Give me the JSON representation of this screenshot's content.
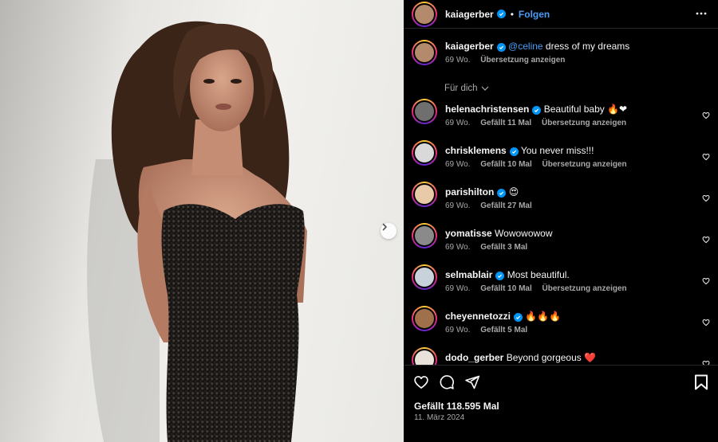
{
  "post": {
    "author": "kaiagerber",
    "follow_label": "Folgen",
    "dot": "•",
    "more_icon": "more-horizontal-icon",
    "caption": {
      "username": "kaiagerber",
      "mention": "@celine",
      "text": " dress of my dreams",
      "age": "69 Wo.",
      "translate": "Übersetzung anzeigen"
    },
    "for_you_label": "Für dich",
    "likes": "Gefällt 118.595 Mal",
    "date": "11. März 2024"
  },
  "comments": [
    {
      "username": "helenachristensen",
      "verified": true,
      "text": "Beautiful baby 🔥❤",
      "age": "69 Wo.",
      "likes": "Gefällt 11 Mal",
      "translate": "Übersetzung anzeigen",
      "avatar_color": "#6f6f6f"
    },
    {
      "username": "chrisklemens",
      "verified": true,
      "text": "You never miss!!!",
      "age": "69 Wo.",
      "likes": "Gefällt 10 Mal",
      "translate": "Übersetzung anzeigen",
      "avatar_color": "#d9d9d9"
    },
    {
      "username": "parishilton",
      "verified": true,
      "text": "😍",
      "age": "69 Wo.",
      "likes": "Gefällt 27 Mal",
      "translate": "",
      "avatar_color": "#e8c9a8"
    },
    {
      "username": "yomatisse",
      "verified": false,
      "text": "Wowowowow",
      "age": "69 Wo.",
      "likes": "Gefällt 3 Mal",
      "translate": "",
      "avatar_color": "#8a8a8a"
    },
    {
      "username": "selmablair",
      "verified": true,
      "text": "Most beautiful.",
      "age": "69 Wo.",
      "likes": "Gefällt 10 Mal",
      "translate": "Übersetzung anzeigen",
      "avatar_color": "#c8d2da"
    },
    {
      "username": "cheyennetozzi",
      "verified": true,
      "text": "🔥🔥🔥",
      "age": "69 Wo.",
      "likes": "Gefällt 5 Mal",
      "translate": "",
      "avatar_color": "#a0704a"
    },
    {
      "username": "dodo_gerber",
      "verified": false,
      "text": "Beyond gorgeous ❤️",
      "age": "",
      "likes": "",
      "translate": "",
      "avatar_color": "#e8e2da"
    }
  ],
  "colors": {
    "background": "#000000",
    "link_blue": "#4a9df7",
    "verified_blue": "#0095f6",
    "muted_text": "#a8a8a8"
  }
}
